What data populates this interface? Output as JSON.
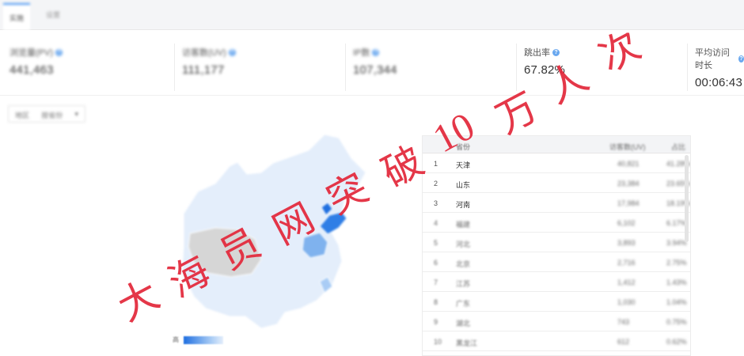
{
  "tabs": [
    {
      "label": "实施",
      "active": true
    },
    {
      "label": "设置"
    }
  ],
  "stats": [
    {
      "label": "浏览量(PV)",
      "value": "441,463",
      "blurred": true
    },
    {
      "label": "访客数(UV)",
      "value": "111,177",
      "blurred": true
    },
    {
      "label": "IP数",
      "value": "107,344",
      "blurred": true
    },
    {
      "label": "跳出率",
      "value": "67.82%",
      "blurred": false
    },
    {
      "label": "平均访问时长",
      "value": "00:06:43",
      "blurred": false
    }
  ],
  "filter": {
    "label": "地区",
    "value": "按省份",
    "icon": "chevron-down-icon"
  },
  "map": {
    "legend_high": "高",
    "colors": {
      "base": "#e4eefb",
      "gray": "#d6d6d6",
      "mid": "#7fb2ee",
      "dark": "#1f6fe0"
    }
  },
  "table": {
    "headers": [
      "省份",
      "访客数(UV)",
      "占比"
    ],
    "rows": [
      {
        "rank": "1",
        "province": "天津",
        "uv": "40,821",
        "share": "41.28%"
      },
      {
        "rank": "2",
        "province": "山东",
        "uv": "23,384",
        "share": "23.65%"
      },
      {
        "rank": "3",
        "province": "河南",
        "uv": "17,984",
        "share": "18.19%"
      },
      {
        "rank": "4",
        "province": "福建",
        "uv": "6,102",
        "share": "6.17%"
      },
      {
        "rank": "5",
        "province": "河北",
        "uv": "3,893",
        "share": "3.94%"
      },
      {
        "rank": "6",
        "province": "北京",
        "uv": "2,716",
        "share": "2.75%"
      },
      {
        "rank": "7",
        "province": "江苏",
        "uv": "1,412",
        "share": "1.43%"
      },
      {
        "rank": "8",
        "province": "广东",
        "uv": "1,030",
        "share": "1.04%"
      },
      {
        "rank": "9",
        "province": "湖北",
        "uv": "743",
        "share": "0.75%"
      },
      {
        "rank": "10",
        "province": "黑龙江",
        "uv": "612",
        "share": "0.62%"
      }
    ]
  },
  "watermark": {
    "chars": [
      "大",
      "海",
      "员",
      "网",
      "突",
      "破",
      "10",
      "万",
      "人",
      "次"
    ],
    "color": "#e3283b"
  }
}
